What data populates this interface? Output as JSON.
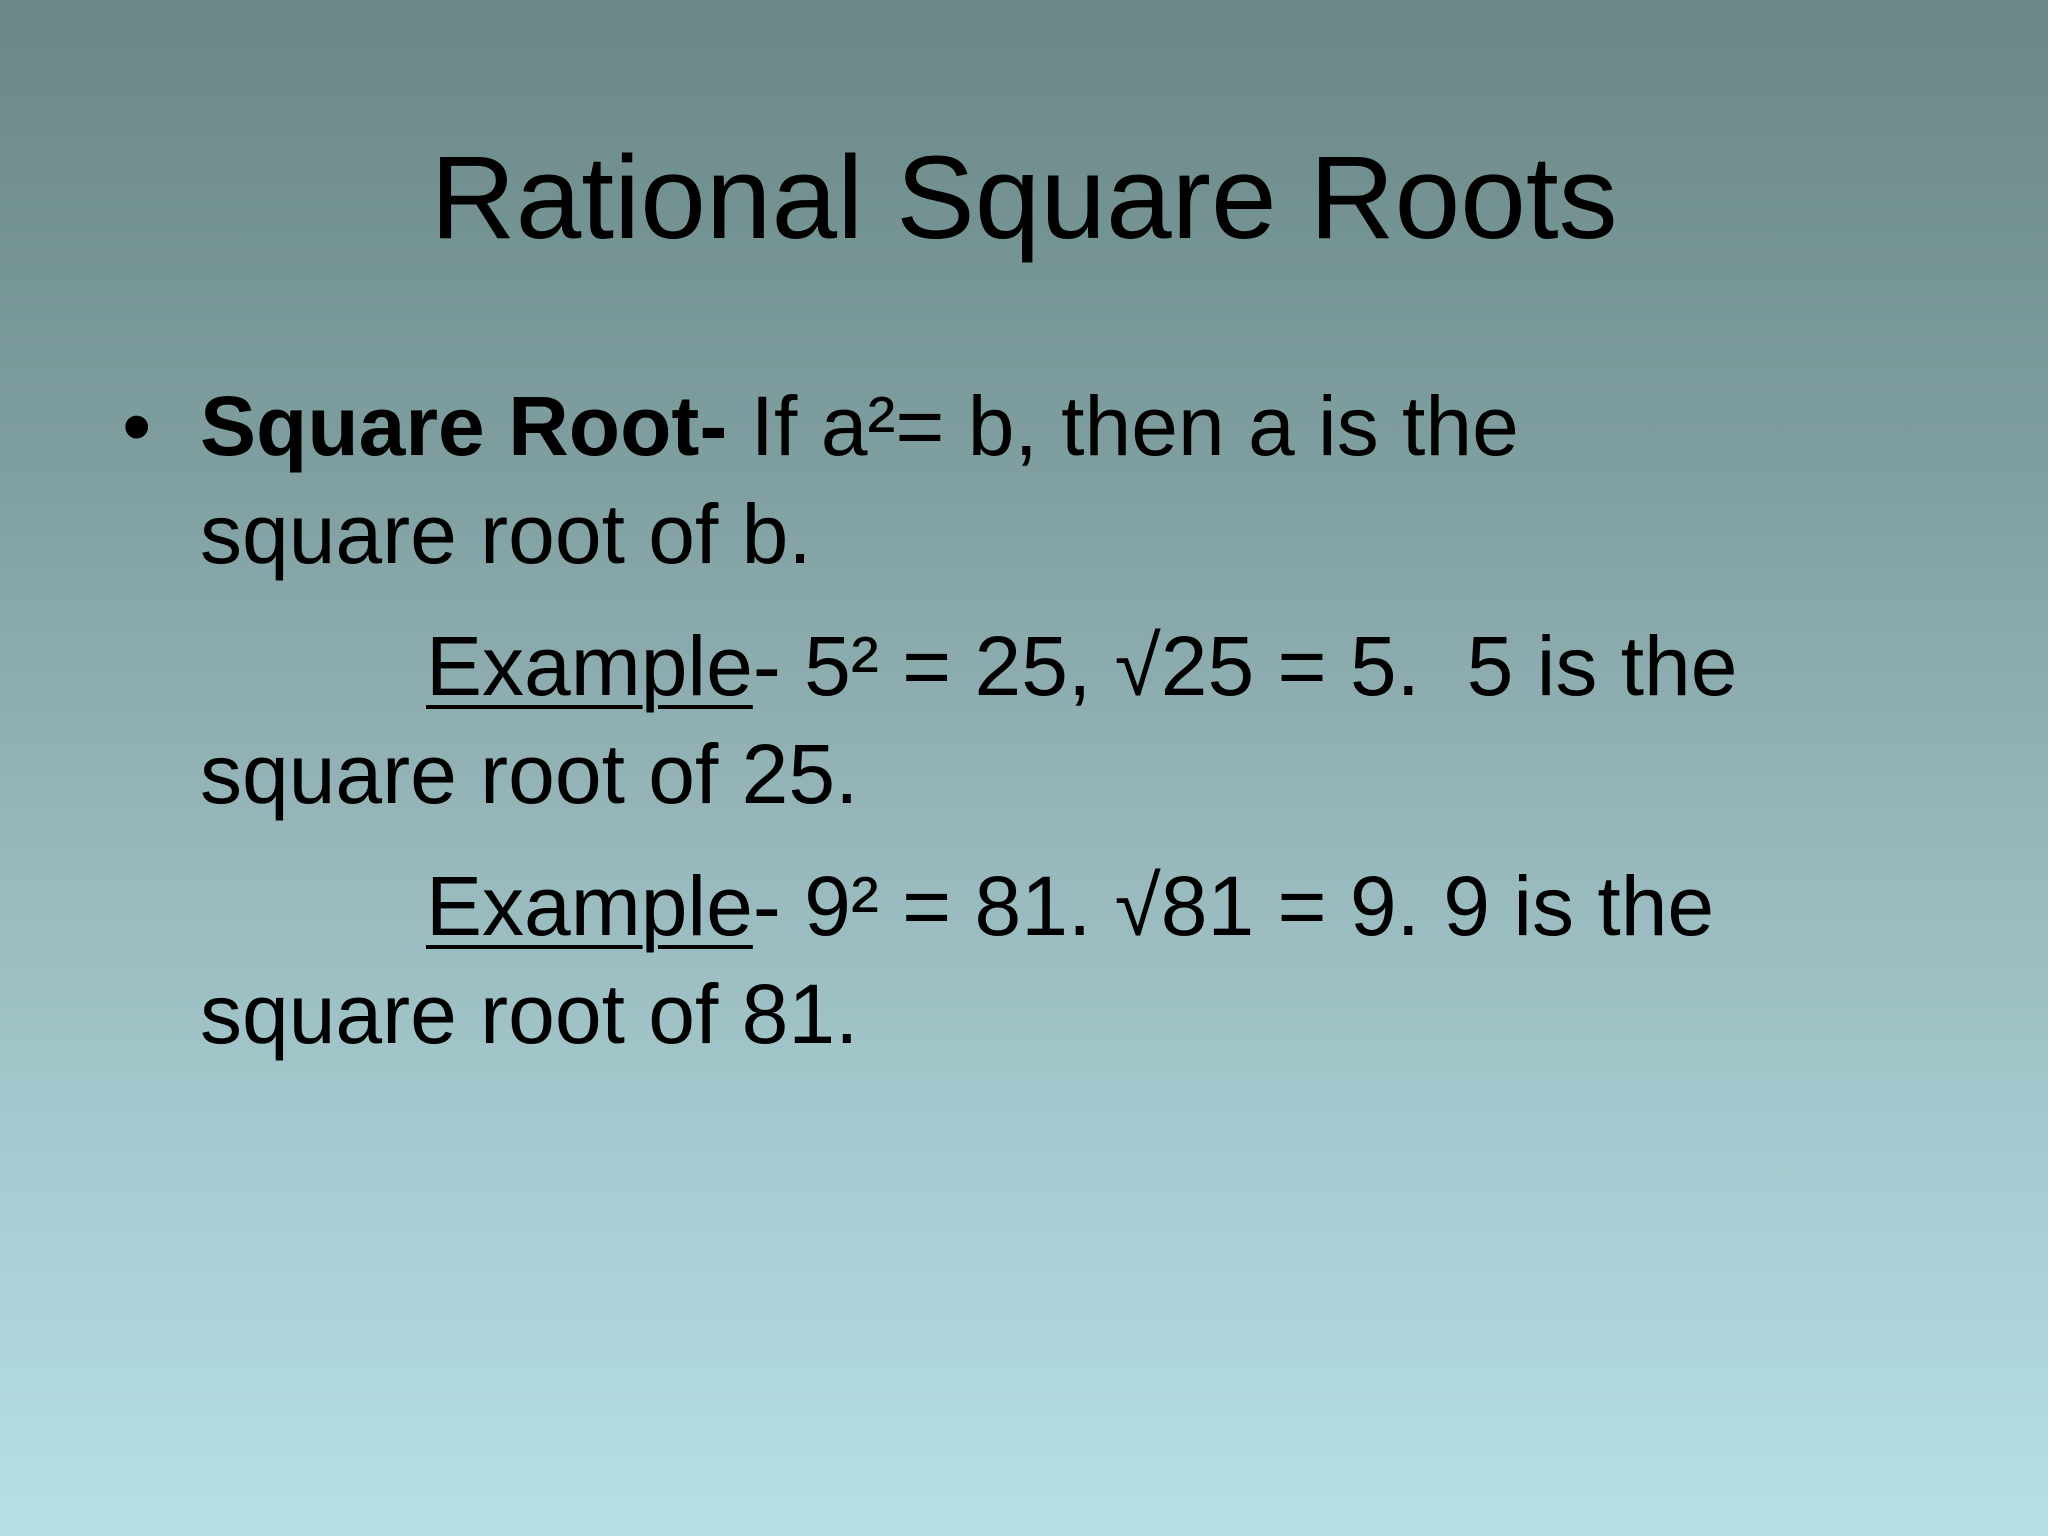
{
  "slide": {
    "title": "Rational Square Roots",
    "bullet_symbol": "•",
    "definition": {
      "term": "Square Root-",
      "line1": " If a²= b, then a is the",
      "line2": "square root of b."
    },
    "examples": [
      {
        "label": "Example",
        "line1": "- 5² = 25, √25 = 5.  5 is the",
        "line2": "square root of 25."
      },
      {
        "label": "Example",
        "line1": "- 9² = 81. √81 = 9. 9 is the",
        "line2": "square root of 81."
      }
    ]
  }
}
